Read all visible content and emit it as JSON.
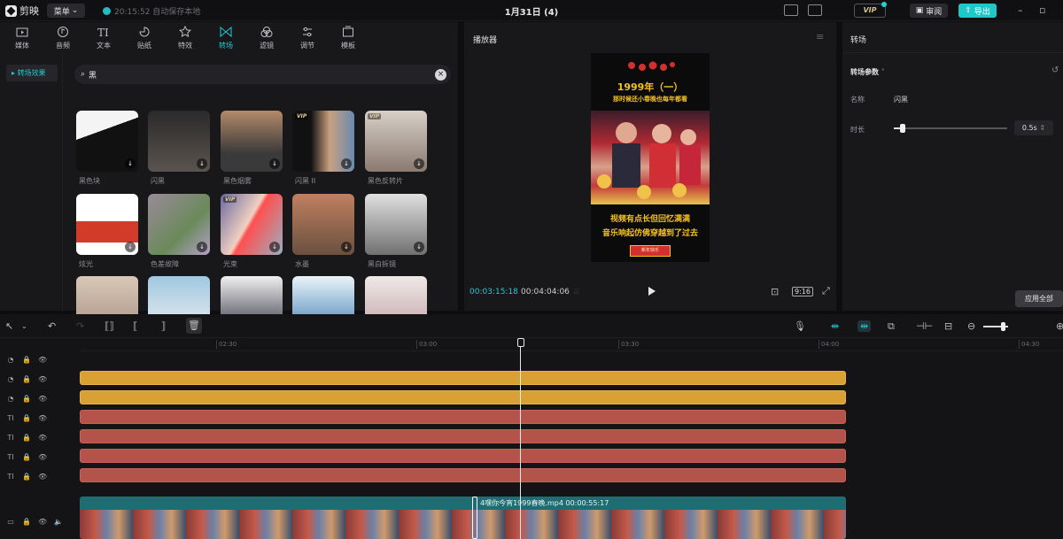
{
  "app": {
    "name": "剪映",
    "menu_label": "菜单",
    "autosave": "20:15:52 自动保存本地",
    "doc_title": "1月31日 (4)",
    "vip": "VIP",
    "review": "审阅",
    "export": "导出"
  },
  "toolbar": {
    "tabs": [
      {
        "label": "媒体",
        "icon": "media-icon"
      },
      {
        "label": "音频",
        "icon": "audio-icon"
      },
      {
        "label": "文本",
        "icon": "text-icon"
      },
      {
        "label": "贴纸",
        "icon": "sticker-icon"
      },
      {
        "label": "特效",
        "icon": "effects-icon"
      },
      {
        "label": "转场",
        "icon": "transition-icon",
        "active": true
      },
      {
        "label": "滤镜",
        "icon": "filter-icon"
      },
      {
        "label": "调节",
        "icon": "adjust-icon"
      },
      {
        "label": "模板",
        "icon": "template-icon"
      }
    ]
  },
  "library": {
    "category": "转场效果",
    "search_value": "黑",
    "items": [
      {
        "name": "黑色块",
        "vip": false
      },
      {
        "name": "闪黑",
        "vip": false
      },
      {
        "name": "黑色烟雾",
        "vip": false
      },
      {
        "name": "闪黑 II",
        "vip": true
      },
      {
        "name": "黑色反转片",
        "vip": true
      },
      {
        "name": "炫光",
        "vip": false
      },
      {
        "name": "色差故障",
        "vip": false
      },
      {
        "name": "光束",
        "vip": true
      },
      {
        "name": "水墨",
        "vip": false
      },
      {
        "name": "黑白拆镜",
        "vip": false
      },
      {
        "name": "",
        "vip": false
      },
      {
        "name": "",
        "vip": false
      },
      {
        "name": "",
        "vip": false
      },
      {
        "name": "",
        "vip": false
      },
      {
        "name": "",
        "vip": false
      }
    ]
  },
  "player": {
    "title": "播放器",
    "video": {
      "title1": "1999年（一）",
      "title2": "那时候还小春晚也每年都看",
      "caption1": "视频有点长但回忆满满",
      "caption2": "音乐响起仿佛穿越到了过去",
      "button": "新年快乐"
    },
    "current_time": "00:03:15:18",
    "total_time": "00:04:04:06",
    "ratio": "9:16"
  },
  "inspector": {
    "title": "转场",
    "section": "转场参数",
    "name_label": "名称",
    "name_value": "闪黑",
    "duration_label": "时长",
    "duration_value": "0.5s",
    "duration_fraction": 0.08,
    "apply_all": "应用全部"
  },
  "timeline": {
    "ruler": [
      "02:30",
      "03:00",
      "03:30",
      "04:00",
      "04:30"
    ],
    "main_clip_label": "4嘿你今宵1999春晚.mp4  00:00:55:17",
    "playhead_time": "00:03:15:18"
  },
  "colors": {
    "accent": "#22c9cf",
    "gold_clip": "#d9a134",
    "red_clip": "#b3534a",
    "main_clip": "#1d6e72"
  }
}
